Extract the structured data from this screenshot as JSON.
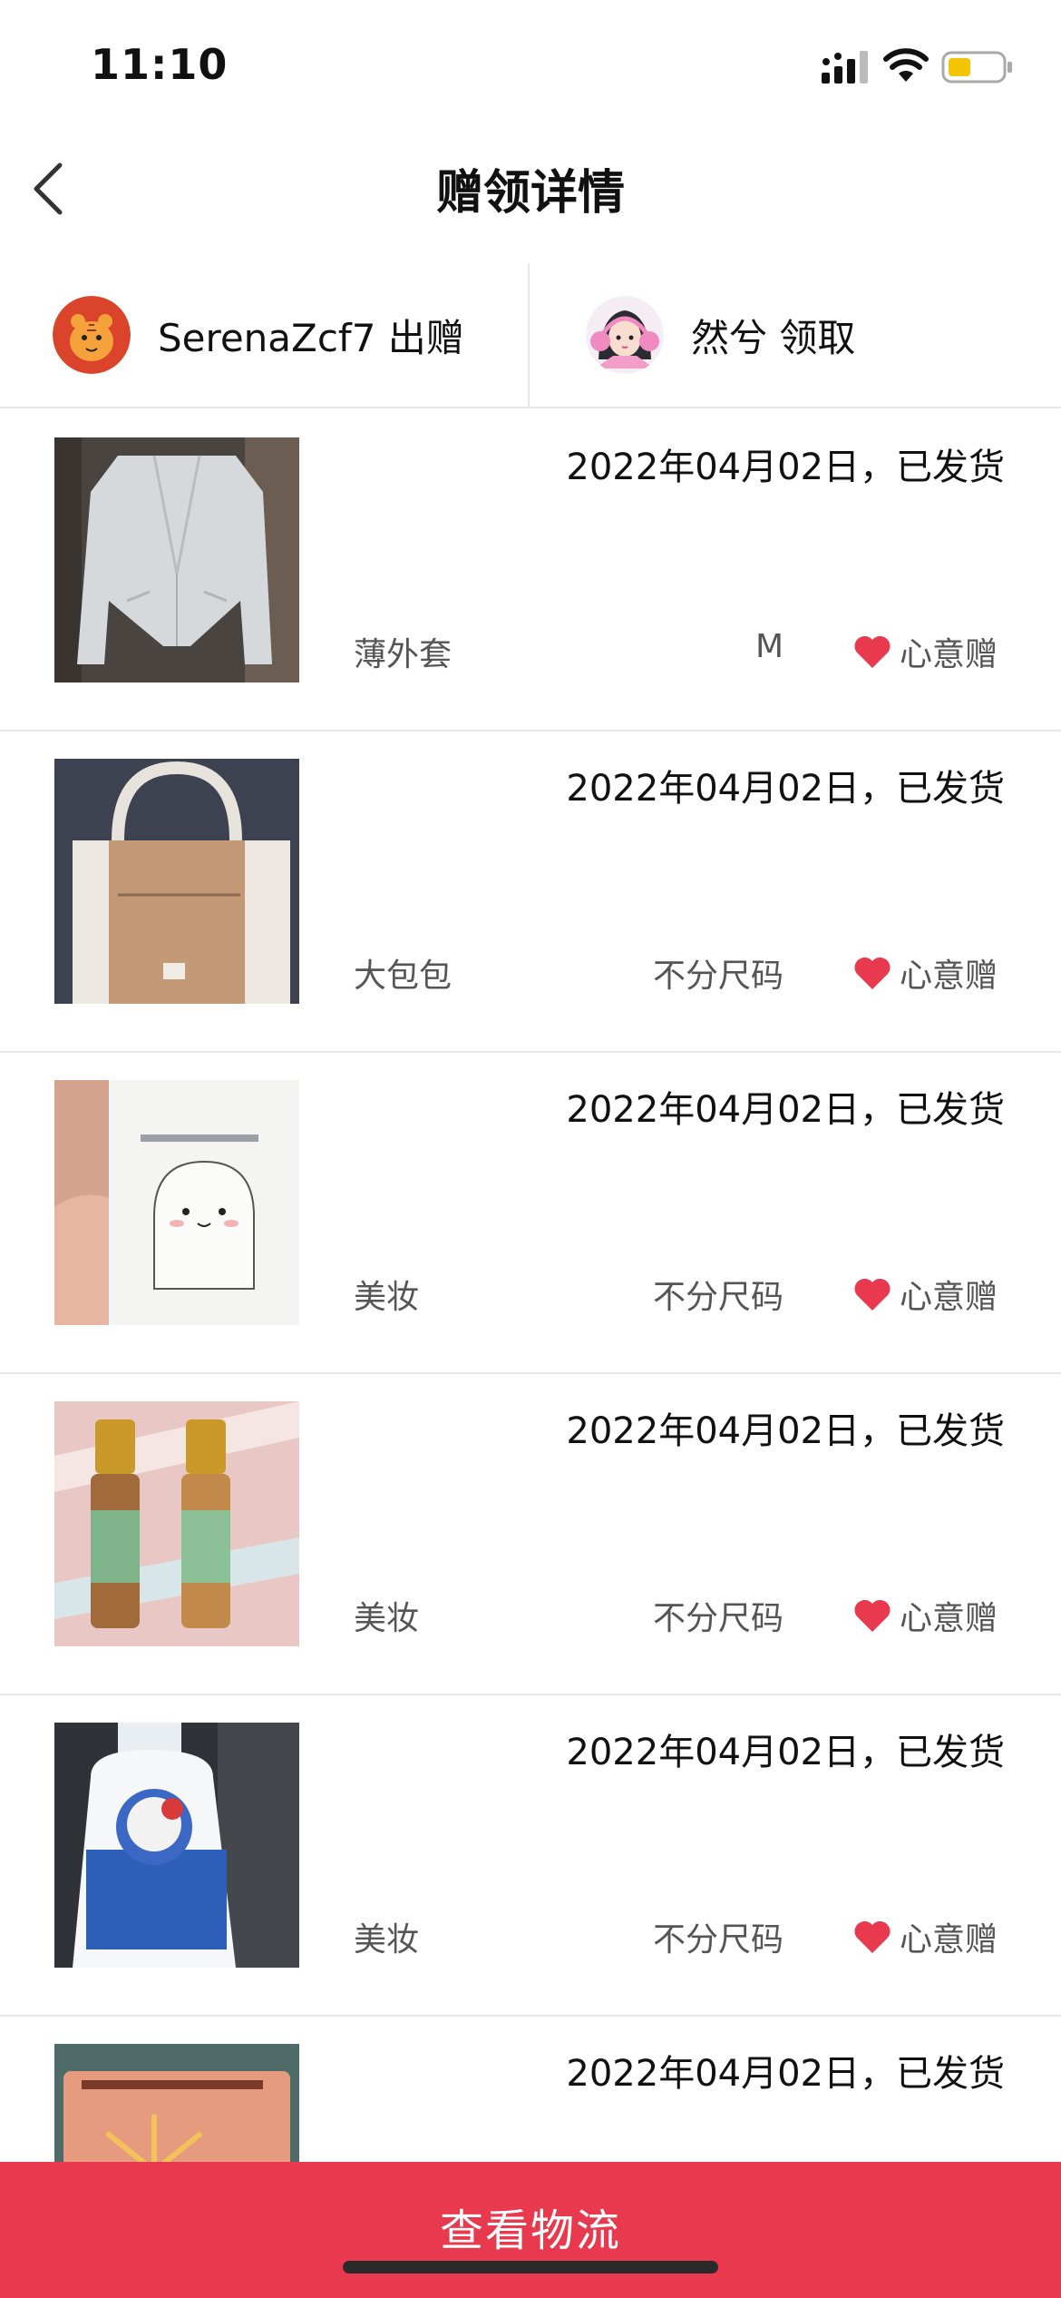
{
  "status_bar": {
    "time": "11:10"
  },
  "nav": {
    "title": "赠领详情"
  },
  "giver": {
    "label": "SerenaZcf7 出赠"
  },
  "receiver": {
    "label": "然兮 领取"
  },
  "items": [
    {
      "date": "2022年04月02日，已发货",
      "name": "薄外套",
      "size": "M",
      "tag": "心意赠",
      "image": "light-grey-jacket-photo"
    },
    {
      "date": "2022年04月02日，已发货",
      "name": "大包包",
      "size": "不分尺码",
      "tag": "心意赠",
      "image": "tote-bag-photo"
    },
    {
      "date": "2022年04月02日，已发货",
      "name": "美妆",
      "size": "不分尺码",
      "tag": "心意赠",
      "image": "makeup-wipe-packet-photo"
    },
    {
      "date": "2022年04月02日，已发货",
      "name": "美妆",
      "size": "不分尺码",
      "tag": "心意赠",
      "image": "perfume-roller-bottles-photo"
    },
    {
      "date": "2022年04月02日，已发货",
      "name": "美妆",
      "size": "不分尺码",
      "tag": "心意赠",
      "image": "lotion-bottle-photo"
    },
    {
      "date": "2022年04月02日，已发货",
      "name": "",
      "size": "",
      "tag": "",
      "image": "product-card-photo"
    }
  ],
  "bottom_button": {
    "label": "查看物流"
  },
  "colors": {
    "accent": "#e8394f",
    "heart": "#e8394f",
    "divider": "#e6e6e6"
  }
}
